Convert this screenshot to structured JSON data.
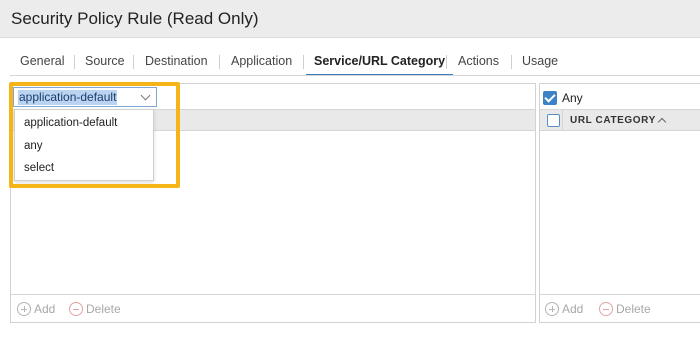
{
  "window": {
    "title": "Security Policy Rule (Read Only)"
  },
  "tabs": [
    {
      "label": "General"
    },
    {
      "label": "Source"
    },
    {
      "label": "Destination"
    },
    {
      "label": "Application"
    },
    {
      "label": "Service/URL Category",
      "active": true
    },
    {
      "label": "Actions"
    },
    {
      "label": "Usage"
    }
  ],
  "service": {
    "select_value": "application-default",
    "options": [
      "application-default",
      "any",
      "select"
    ],
    "add_label": "Add",
    "delete_label": "Delete"
  },
  "url_category": {
    "any_label": "Any",
    "any_checked": true,
    "column_header": "URL CATEGORY",
    "add_label": "Add",
    "delete_label": "Delete"
  },
  "colors": {
    "highlight": "#f5b519",
    "accent": "#3b83c6",
    "selection": "#b9d3f1"
  }
}
